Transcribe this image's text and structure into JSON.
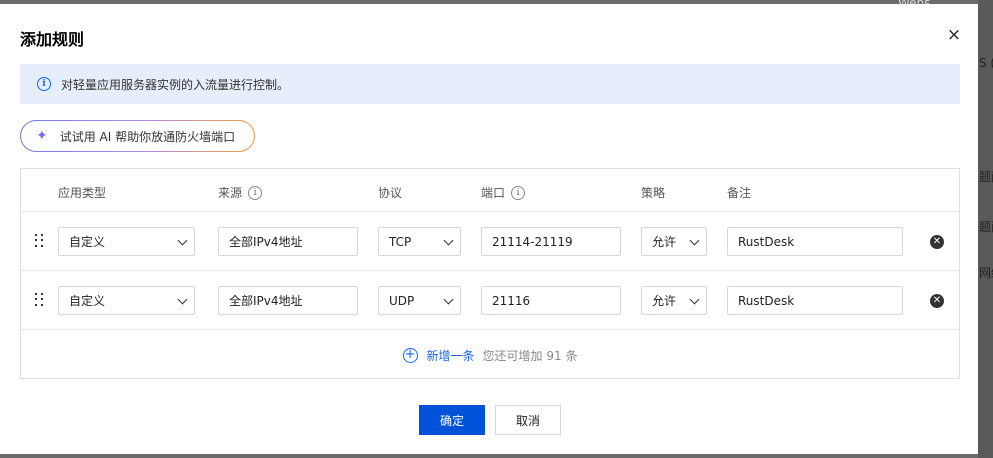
{
  "modal": {
    "title": "添加规则",
    "close_glyph": "×",
    "info_text": "对轻量应用服务器实例的入流量进行控制。",
    "ai_button_label": "试试用 AI 帮助你放通防火墙端口"
  },
  "table": {
    "headers": {
      "app_type": "应用类型",
      "source": "来源",
      "protocol": "协议",
      "port": "端口",
      "policy": "策略",
      "remark": "备注"
    },
    "rows": [
      {
        "app_type": "自定义",
        "source": "全部IPv4地址",
        "protocol": "TCP",
        "port": "21114-21119",
        "policy": "允许",
        "remark": "RustDesk"
      },
      {
        "app_type": "自定义",
        "source": "全部IPv4地址",
        "protocol": "UDP",
        "port": "21116",
        "policy": "允许",
        "remark": "RustDesk"
      }
    ],
    "add_label": "新增一条",
    "add_hint": "您还可增加 91 条"
  },
  "footer": {
    "ok_label": "确定",
    "cancel_label": "取消"
  },
  "background": {
    "top_text": "Webs...",
    "side_texts": [
      "S (",
      "题面",
      "题面",
      "网络"
    ]
  },
  "colors": {
    "primary": "#0052d9",
    "link": "#1664ff",
    "info_bg": "#e6edfb"
  }
}
